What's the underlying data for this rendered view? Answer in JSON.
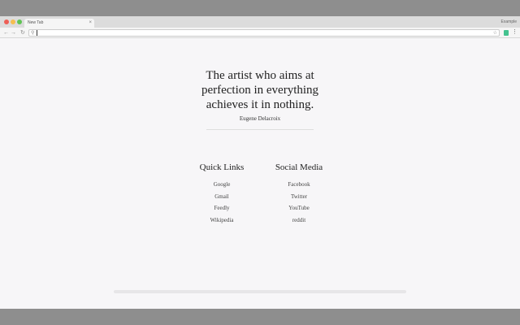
{
  "browser": {
    "tab_title": "New Tab",
    "tab_close": "×",
    "profile_name": "Example",
    "url": ""
  },
  "icons": {
    "back": "back-arrow-icon",
    "forward": "forward-arrow-icon",
    "reload": "reload-icon",
    "search": "search-icon",
    "star": "star-icon",
    "extension": "extension-icon",
    "menu": "menu-icon"
  },
  "quote": {
    "text_lines": [
      "The artist who aims at",
      "perfection in everything",
      "achieves it in nothing."
    ],
    "author": "Eugene Delacroix"
  },
  "quick_links": {
    "title": "Quick Links",
    "items": [
      "Google",
      "Gmail",
      "Feedly",
      "Wikipedia"
    ]
  },
  "social_media": {
    "title": "Social Media",
    "items": [
      "Facebook",
      "Twitter",
      "YouTube",
      "reddit"
    ]
  },
  "colors": {
    "background": "#f7f6f8",
    "text": "#222222",
    "extension_accent": "#44c28f"
  }
}
